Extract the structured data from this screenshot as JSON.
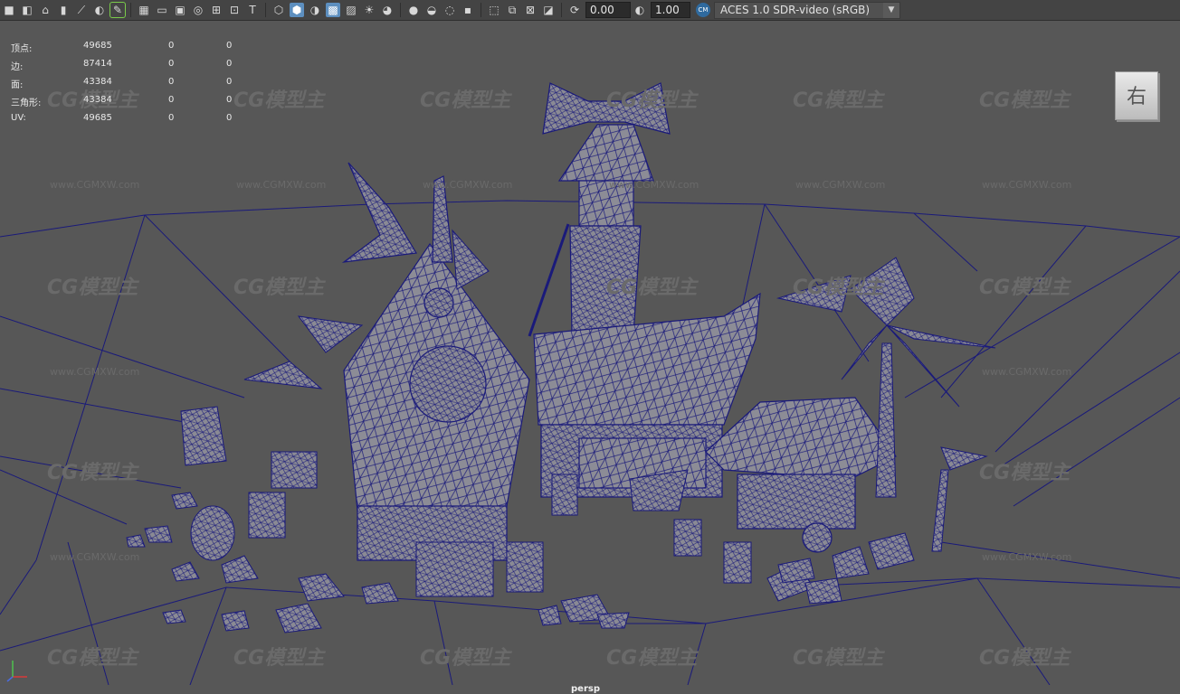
{
  "toolbar": {
    "icons": [
      "camera-icon",
      "camera-attributes-icon",
      "bookmark-icon",
      "image-plane-icon",
      "grid-icon",
      "film-gate-icon",
      "resolution-gate-icon",
      "gate-mask-icon",
      "field-chart-icon",
      "safe-action-icon",
      "safe-title-icon",
      "wireframe-icon",
      "smooth-shade-icon",
      "default-material-icon",
      "textured-icon",
      "use-lights-icon",
      "shadows-icon",
      "ambient-occlusion-icon",
      "isolate-icon",
      "xray-icon",
      "xray-joints-icon",
      "backface-icon",
      "exposure-icon",
      "gamma-icon",
      "color-management-icon"
    ],
    "exposure": "0.00",
    "gamma": "1.00",
    "color_space": "ACES 1.0 SDR-video (sRGB)"
  },
  "hud": {
    "rows": [
      {
        "label": "顶点:",
        "v1": "49685",
        "v2": "0",
        "v3": "0"
      },
      {
        "label": "边:",
        "v1": "87414",
        "v2": "0",
        "v3": "0"
      },
      {
        "label": "面:",
        "v1": "43384",
        "v2": "0",
        "v3": "0"
      },
      {
        "label": "三角形:",
        "v1": "43384",
        "v2": "0",
        "v3": "0"
      },
      {
        "label": "UV:",
        "v1": "49685",
        "v2": "0",
        "v3": "0"
      }
    ]
  },
  "viewcube": {
    "label": "右"
  },
  "camera": {
    "label": "persp"
  },
  "watermark": {
    "brand": "CG模型主",
    "url": "www.CGMXW.com"
  },
  "colors": {
    "background": "#575757",
    "wireframe": "#1a1a7a",
    "mesh_fill": "#8c8c96",
    "toolbar": "#444444"
  }
}
